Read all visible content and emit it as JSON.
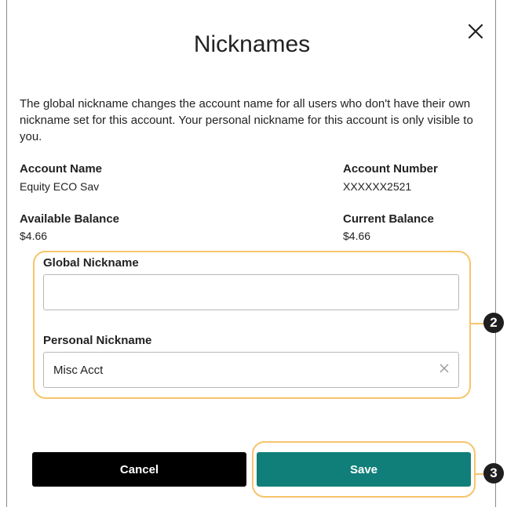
{
  "dialog": {
    "title": "Nicknames",
    "description": "The global nickname changes the account name for all users who don't have their own nickname set for this account. Your personal nickname for this account is only visible to you.",
    "close_icon": "close-icon"
  },
  "account": {
    "name_label": "Account Name",
    "name_value": "Equity ECO Sav",
    "number_label": "Account Number",
    "number_value": "XXXXXX2521",
    "available_label": "Available Balance",
    "available_value": "$4.66",
    "current_label": "Current Balance",
    "current_value": "$4.66"
  },
  "form": {
    "global_label": "Global Nickname",
    "global_value": "",
    "personal_label": "Personal Nickname",
    "personal_value": "Misc Acct",
    "clear_icon": "clear-icon"
  },
  "buttons": {
    "cancel_label": "Cancel",
    "save_label": "Save"
  },
  "callouts": {
    "step_two": "2",
    "step_three": "3",
    "highlight_color": "#f7c46c"
  },
  "colors": {
    "save_button": "#107f7a",
    "cancel_button": "#000000"
  }
}
